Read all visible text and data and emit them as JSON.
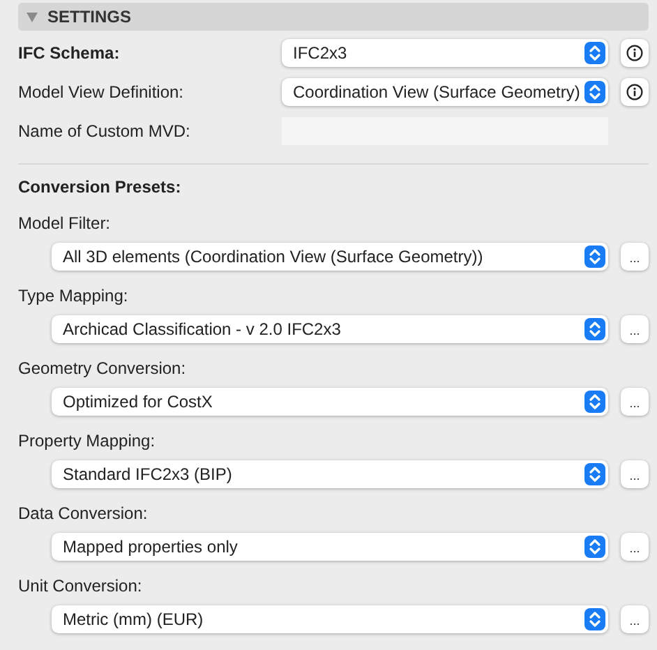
{
  "section": {
    "title": "SETTINGS",
    "expanded": true
  },
  "fields": [
    {
      "kind": "select",
      "label": "IFC Schema:",
      "bold": true,
      "value": "IFC2x3",
      "info": true
    },
    {
      "kind": "select",
      "label": "Model View Definition:",
      "bold": false,
      "value": "Coordination View (Surface Geometry)",
      "info": true
    },
    {
      "kind": "text",
      "label": "Name of Custom MVD:",
      "bold": false
    }
  ],
  "presets_title": "Conversion Presets:",
  "presets": [
    {
      "label": "Model Filter:",
      "value": "All 3D elements (Coordination View (Surface Geometry))",
      "more": "..."
    },
    {
      "label": "Type Mapping:",
      "value": "Archicad Classification - v 2.0 IFC2x3",
      "more": "..."
    },
    {
      "label": "Geometry Conversion:",
      "value": "Optimized for CostX",
      "more": "..."
    },
    {
      "label": "Property Mapping:",
      "value": "Standard IFC2x3 (BIP)",
      "more": "..."
    },
    {
      "label": "Data Conversion:",
      "value": "Mapped properties only",
      "more": "..."
    },
    {
      "label": "Unit Conversion:",
      "value": "Metric (mm) (EUR)",
      "more": "..."
    }
  ]
}
